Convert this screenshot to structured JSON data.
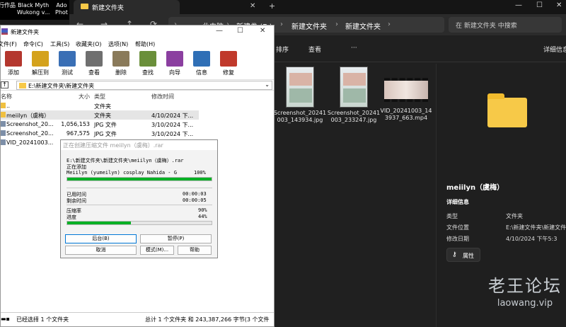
{
  "desktop": {
    "items": [
      {
        "label": "行作品"
      },
      {
        "label": "Black Myth\nWukong v..."
      },
      {
        "label": "Ado\nPhot"
      }
    ]
  },
  "explorer": {
    "tab_label": "新建文件夹",
    "tab_close": "✕",
    "tab_add": "+",
    "window_controls": {
      "minimize": "—",
      "maximize": "☐",
      "close": "✕"
    },
    "nav": {
      "back": "←",
      "forward": "→",
      "up": "↑",
      "refresh": "⟳"
    },
    "breadcrumbs": [
      "此电脑",
      "新建卷 (E:)",
      "新建文件夹",
      "新建文件夹"
    ],
    "crumb_separator": "›",
    "search_placeholder": "在 新建文件夹 中搜索",
    "toolbar": {
      "sort": "排序",
      "view": "查看",
      "more": "···",
      "details": "详细信息"
    },
    "files": [
      {
        "name": "Screenshot_20241003_143934.jpg",
        "kind": "image"
      },
      {
        "name": "Screenshot_20241003_233247.jpg",
        "kind": "image"
      },
      {
        "name": "VID_20241003_143937_663.mp4",
        "kind": "video"
      }
    ],
    "details_pane": {
      "title": "meiilyn（虞梅）",
      "section": "详细信息",
      "props": [
        {
          "label": "类型",
          "value": "文件夹"
        },
        {
          "label": "文件位置",
          "value": "E:\\新建文件夹\\新建文件夹"
        },
        {
          "label": "修改日期",
          "value": "4/10/2024 下午5:3"
        }
      ],
      "properties_button": "属性"
    }
  },
  "winrar": {
    "title": "新建文件夹",
    "controls": {
      "minimize": "—",
      "maximize": "☐",
      "close": "✕"
    },
    "menu": [
      "文件(F)",
      "命令(C)",
      "工具(S)",
      "收藏夹(O)",
      "选项(N)",
      "帮助(H)"
    ],
    "toolbar": [
      {
        "label": "添加",
        "color": "#b4372e"
      },
      {
        "label": "解压到",
        "color": "#d4a21c"
      },
      {
        "label": "测试",
        "color": "#3a6fb5"
      },
      {
        "label": "查看",
        "color": "#6f6f6f"
      },
      {
        "label": "删除",
        "color": "#8a7a5a"
      },
      {
        "label": "查找",
        "color": "#6a8f3a"
      },
      {
        "label": "向导",
        "color": "#8b3fa0"
      },
      {
        "label": "信息",
        "color": "#2f6fb6"
      },
      {
        "label": "修复",
        "color": "#c0392b"
      }
    ],
    "path": "E:\\新建文件夹\\新建文件夹",
    "columns": {
      "name": "名称",
      "size": "大小",
      "type": "类型",
      "modified": "修改时间"
    },
    "rows": [
      {
        "name": "..",
        "size": "",
        "type": "文件夹",
        "modified": ""
      },
      {
        "name": "meiilyn（虞梅）",
        "size": "",
        "type": "文件夹",
        "modified": "4/10/2024 下...",
        "selected": true
      },
      {
        "name": "Screenshot_20...",
        "size": "1,056,153",
        "type": "JPG 文件",
        "modified": "3/10/2024 下..."
      },
      {
        "name": "Screenshot_20...",
        "size": "967,575",
        "type": "JPG 文件",
        "modified": "3/10/2024 下..."
      },
      {
        "name": "VID_20241003...",
        "size": "2",
        "type": "",
        "modified": ""
      }
    ],
    "status_left": "已经选择 1 个文件夹",
    "status_right": "总计 1 个文件夹 和 243,387,266 字节(3 个文件"
  },
  "progress_dialog": {
    "title": "正在创建压缩文件 meiilyn（虞梅）.rar",
    "archive_line": "E:\\新建文件夹\\新建文件夹\\meiilyn（虞梅）.rar",
    "action": "正在添加",
    "current_file": "Meiilyn (yumeilyn) cosplay Nahida - G",
    "file_percent": "100%",
    "file_progress": 1.0,
    "elapsed_label": "已用时间",
    "elapsed": "00:00:03",
    "remaining_label": "剩余时间",
    "remaining": "00:00:05",
    "ratio_label": "压缩率",
    "ratio": "90%",
    "progress_label": "进度",
    "total_percent": "44%",
    "total_progress": 0.44,
    "buttons": {
      "background": "后台(B)",
      "pause": "暂停(P)",
      "cancel": "取消",
      "mode": "模式(M)...",
      "help": "帮助"
    }
  },
  "watermark": {
    "main": "老王论坛",
    "sub": "laowang.vip"
  }
}
